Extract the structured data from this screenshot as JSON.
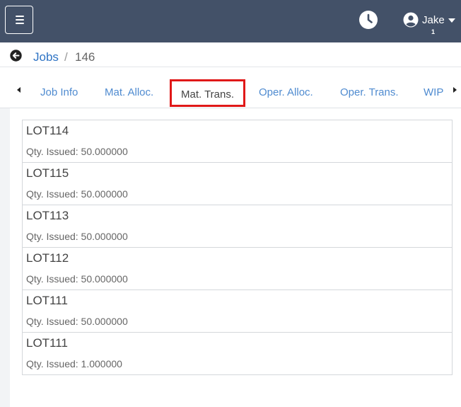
{
  "header": {
    "user_name": "Jake",
    "user_badge": "1",
    "colors": {
      "topbar": "#435168",
      "accent": "#2e73c4",
      "highlight": "#e01818"
    }
  },
  "breadcrumb": {
    "link": "Jobs",
    "separator": "/",
    "current": "146"
  },
  "tabs": [
    {
      "label": "Job Info"
    },
    {
      "label": "Mat. Alloc."
    },
    {
      "label": "Mat. Trans.",
      "active": true
    },
    {
      "label": "Oper. Alloc."
    },
    {
      "label": "Oper. Trans."
    },
    {
      "label": "WIP"
    }
  ],
  "transactions": [
    {
      "lot": "LOT114",
      "qty": "Qty. Issued: 50.000000"
    },
    {
      "lot": "LOT115",
      "qty": "Qty. Issued: 50.000000"
    },
    {
      "lot": "LOT113",
      "qty": "Qty. Issued: 50.000000"
    },
    {
      "lot": "LOT112",
      "qty": "Qty. Issued: 50.000000"
    },
    {
      "lot": "LOT111",
      "qty": "Qty. Issued: 50.000000"
    },
    {
      "lot": "LOT111",
      "qty": "Qty. Issued: 1.000000"
    }
  ]
}
